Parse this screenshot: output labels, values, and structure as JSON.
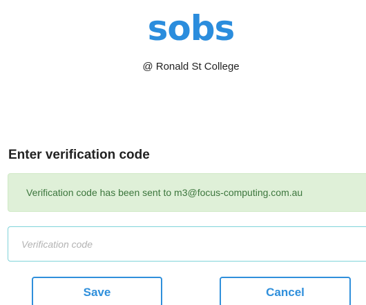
{
  "header": {
    "logo_text": "sobs",
    "college": "@ Ronald St College"
  },
  "form": {
    "heading": "Enter verification code",
    "alert_message": "Verification code has been sent to m3@focus-computing.com.au",
    "code_placeholder": "Verification code",
    "code_value": "",
    "save_label": "Save",
    "cancel_label": "Cancel"
  },
  "colors": {
    "brand": "#2b8ddd",
    "alert_bg": "#dff0d8",
    "alert_text": "#3c763d",
    "input_border": "#7fd3d9",
    "button_accent": "#2f8fdb"
  }
}
